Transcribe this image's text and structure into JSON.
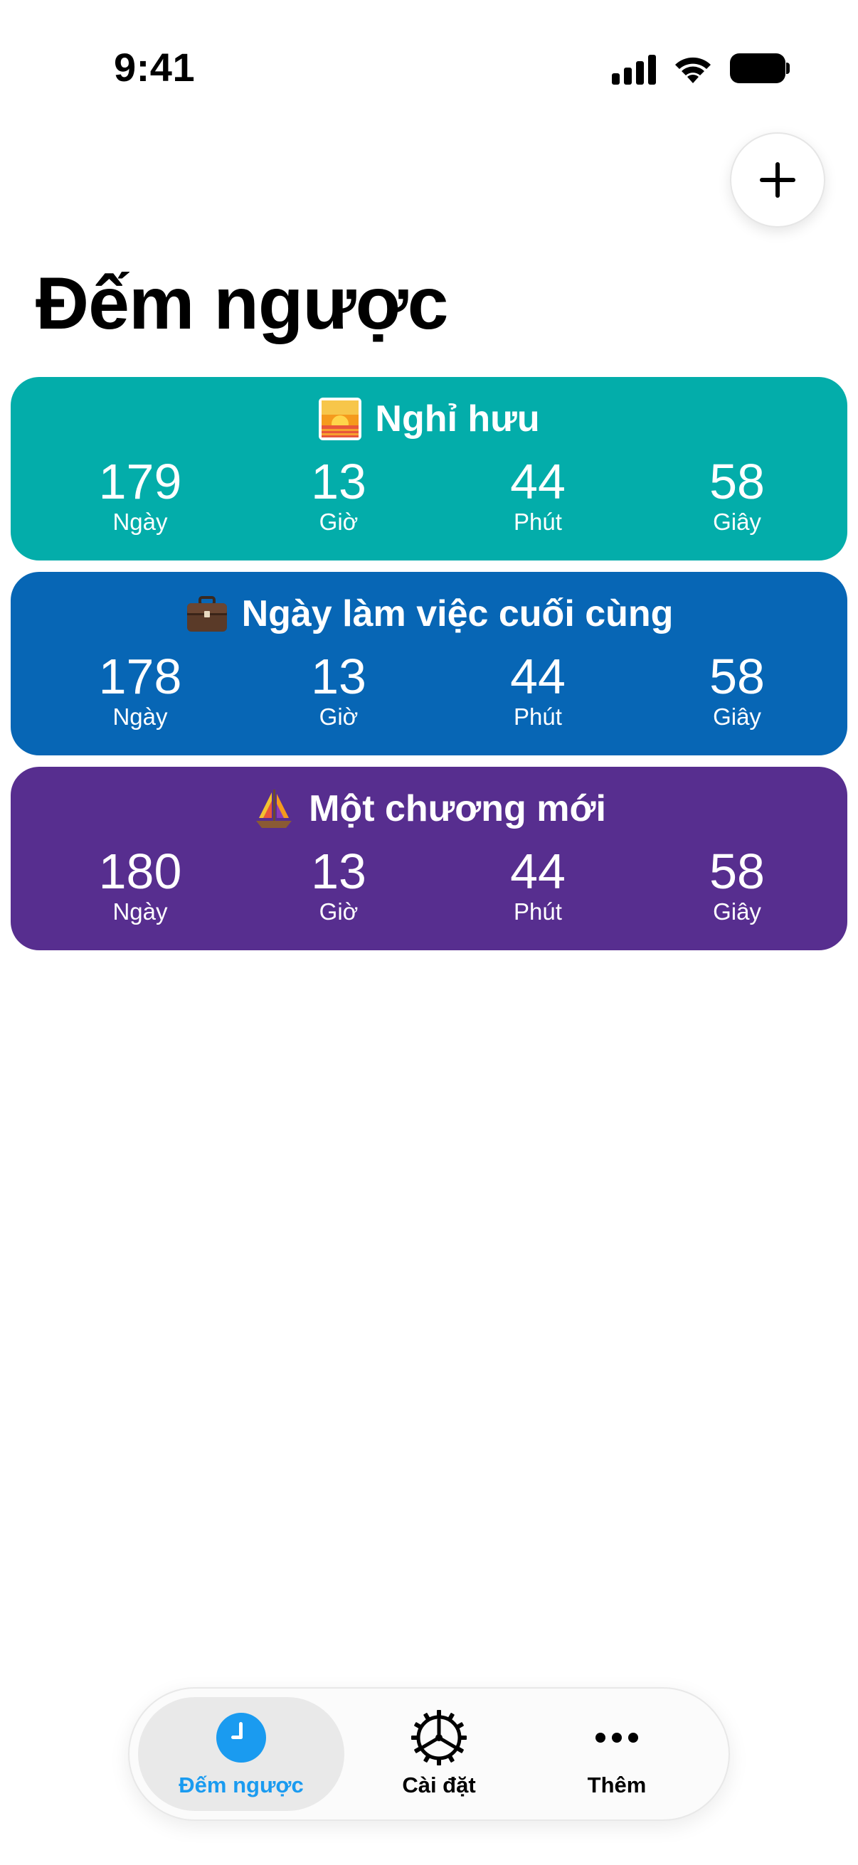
{
  "status_bar": {
    "time": "9:41",
    "icons": [
      "cellular-signal-icon",
      "wifi-icon",
      "battery-icon"
    ]
  },
  "header": {
    "add_button_icon": "plus-icon",
    "title": "Đếm ngược"
  },
  "countdowns": [
    {
      "emoji": "sunrise-emoji",
      "title": "Nghỉ hưu",
      "color": "#03ADAA",
      "units": [
        {
          "value": "179",
          "label": "Ngày"
        },
        {
          "value": "13",
          "label": "Giờ"
        },
        {
          "value": "44",
          "label": "Phút"
        },
        {
          "value": "58",
          "label": "Giây"
        }
      ]
    },
    {
      "emoji": "briefcase-emoji",
      "title": "Ngày làm việc cuối cùng",
      "color": "#0766B5",
      "units": [
        {
          "value": "178",
          "label": "Ngày"
        },
        {
          "value": "13",
          "label": "Giờ"
        },
        {
          "value": "44",
          "label": "Phút"
        },
        {
          "value": "58",
          "label": "Giây"
        }
      ]
    },
    {
      "emoji": "sailboat-emoji",
      "title": "Một chương mới",
      "color": "#572E8F",
      "units": [
        {
          "value": "180",
          "label": "Ngày"
        },
        {
          "value": "13",
          "label": "Giờ"
        },
        {
          "value": "44",
          "label": "Phút"
        },
        {
          "value": "58",
          "label": "Giây"
        }
      ]
    }
  ],
  "tab_bar": {
    "active_color": "#1A9BF0",
    "tabs": [
      {
        "label": "Đếm ngược",
        "icon": "clock-icon",
        "active": true
      },
      {
        "label": "Cài đặt",
        "icon": "gear-icon",
        "active": false
      },
      {
        "label": "Thêm",
        "icon": "more-dots-icon",
        "active": false
      }
    ]
  }
}
